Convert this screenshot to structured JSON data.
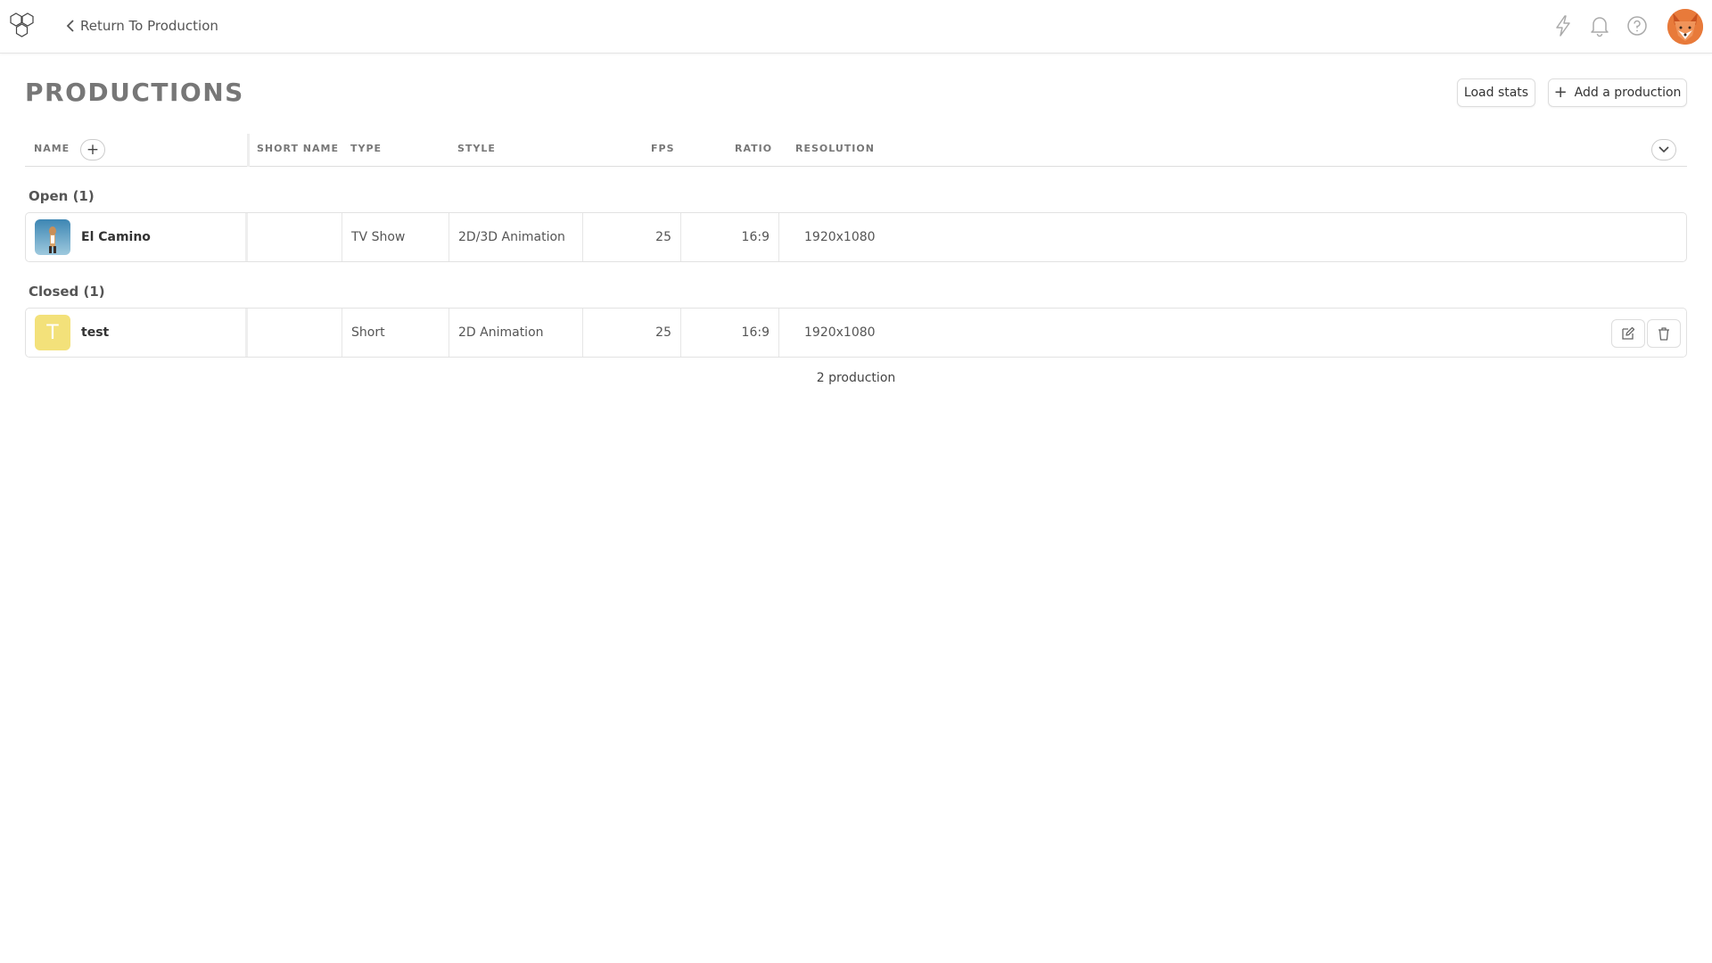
{
  "topbar": {
    "back_label": "Return To Production",
    "icons": [
      "logo-icon",
      "lightning-icon",
      "bell-icon",
      "help-icon",
      "user-avatar"
    ]
  },
  "page": {
    "title": "PRODUCTIONS",
    "load_stats_label": "Load stats",
    "add_production_label": "Add a production"
  },
  "table": {
    "columns": {
      "name": "NAME",
      "short_name": "SHORT NAME",
      "type": "TYPE",
      "style": "STYLE",
      "fps": "FPS",
      "ratio": "RATIO",
      "resolution": "RESOLUTION"
    },
    "groups": [
      {
        "label": "Open (1)",
        "rows": [
          {
            "name": "El Camino",
            "short_name": "",
            "type": "TV Show",
            "style": "2D/3D Animation",
            "fps": "25",
            "ratio": "16:9",
            "resolution": "1920x1080",
            "thumb": "image"
          }
        ]
      },
      {
        "label": "Closed (1)",
        "rows": [
          {
            "name": "test",
            "short_name": "",
            "type": "Short",
            "style": "2D Animation",
            "fps": "25",
            "ratio": "16:9",
            "resolution": "1920x1080",
            "thumb": "T"
          }
        ]
      }
    ],
    "footer": "2 production"
  },
  "colors": {
    "thumb_letter_bg": "#f3e17a",
    "avatar_bg": "#e06a2a",
    "title_color": "#777777"
  }
}
